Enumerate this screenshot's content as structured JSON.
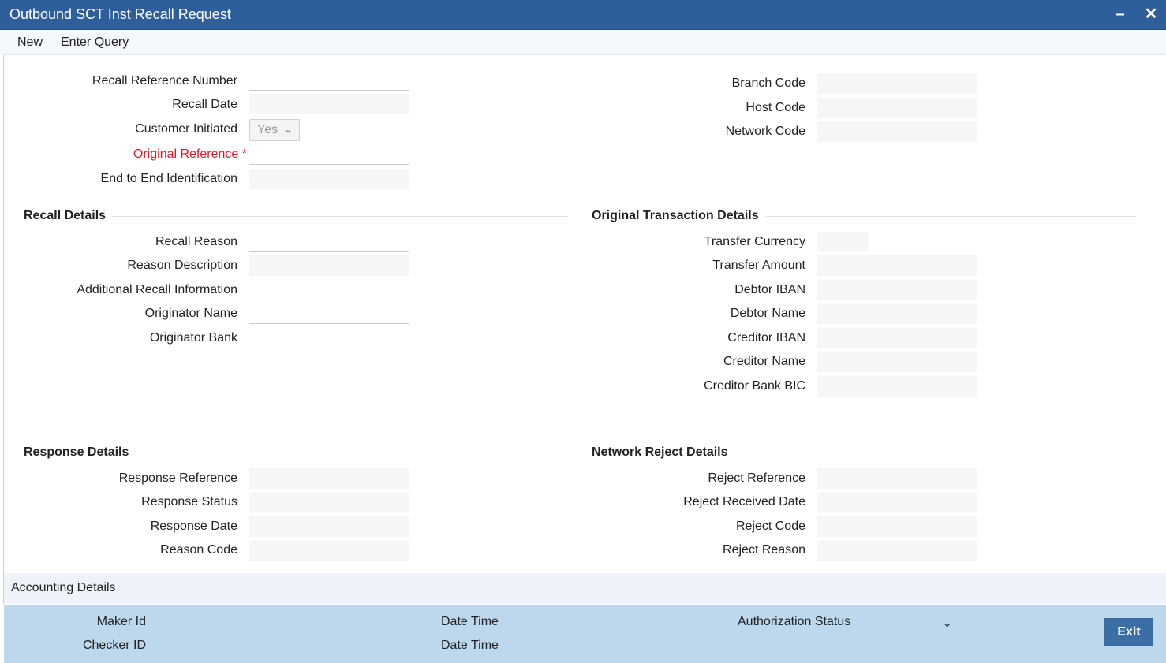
{
  "window": {
    "title": "Outbound SCT Inst Recall Request",
    "minimize_icon": "minus-icon",
    "close_icon": "close-icon"
  },
  "menu": {
    "new": "New",
    "enter_query": "Enter Query"
  },
  "header_fields": {
    "recall_reference_number": "Recall Reference Number",
    "recall_date": "Recall Date",
    "customer_initiated": "Customer Initiated",
    "customer_initiated_value": "Yes",
    "original_reference": "Original Reference",
    "required_marker": "*",
    "end_to_end_identification": "End to End Identification",
    "branch_code": "Branch Code",
    "host_code": "Host Code",
    "network_code": "Network Code"
  },
  "recall_details": {
    "title": "Recall Details",
    "recall_reason": "Recall Reason",
    "reason_description": "Reason Description",
    "additional_recall_information": "Additional Recall Information",
    "originator_name": "Originator Name",
    "originator_bank": "Originator Bank"
  },
  "original_transaction_details": {
    "title": "Original Transaction Details",
    "transfer_currency": "Transfer Currency",
    "transfer_amount": "Transfer Amount",
    "debtor_iban": "Debtor IBAN",
    "debtor_name": "Debtor Name",
    "creditor_iban": "Creditor IBAN",
    "creditor_name": "Creditor Name",
    "creditor_bank_bic": "Creditor Bank BIC"
  },
  "response_details": {
    "title": "Response Details",
    "response_reference": "Response Reference",
    "response_status": "Response Status",
    "response_date": "Response Date",
    "reason_code": "Reason Code"
  },
  "network_reject_details": {
    "title": "Network Reject Details",
    "reject_reference": "Reject Reference",
    "reject_received_date": "Reject Received Date",
    "reject_code": "Reject Code",
    "reject_reason": "Reject Reason"
  },
  "accounting_details": {
    "label": "Accounting Details"
  },
  "footer": {
    "maker_id": "Maker Id",
    "checker_id": "Checker ID",
    "date_time_1": "Date Time",
    "date_time_2": "Date Time",
    "authorization_status": "Authorization Status",
    "exit": "Exit"
  },
  "colors": {
    "titlebar": "#2f5f9a",
    "required": "#d0202e",
    "footer": "#bdd7ec",
    "exit_button": "#3a6ea5"
  }
}
